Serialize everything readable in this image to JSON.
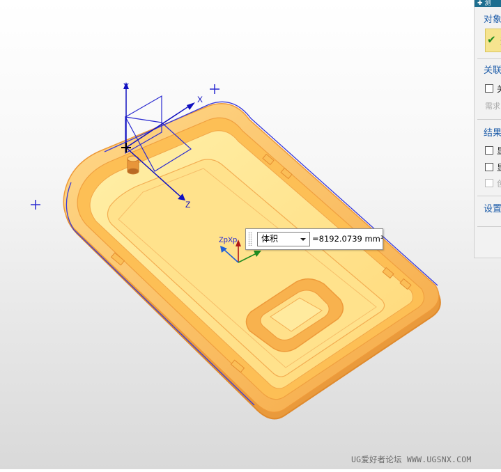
{
  "panel": {
    "title": "✚ 测",
    "sections": {
      "objects": "对象",
      "objects_select": "选",
      "associativity": "关联",
      "assoc_checkbox": "关",
      "assoc_hint": "需求",
      "results": "结果",
      "result_item_1": "显",
      "result_item_2": "显",
      "result_item_3": "创",
      "settings": "设置"
    }
  },
  "measure": {
    "dropdown_value": "体积",
    "result_text": "=8192.0739 mm³"
  },
  "axes": {
    "wcs": {
      "x": "X",
      "y": "Y",
      "z": "Z"
    },
    "csys": "ZpXp"
  },
  "watermark": "UG爱好者论坛 WWW.UGSNX.COM",
  "colors": {
    "part_fill": "#fdc25a",
    "part_edge": "#f0a040",
    "selection_edge": "#3a3ad8",
    "panel_header": "#1e6e8f",
    "section_text": "#1a5aa8"
  }
}
